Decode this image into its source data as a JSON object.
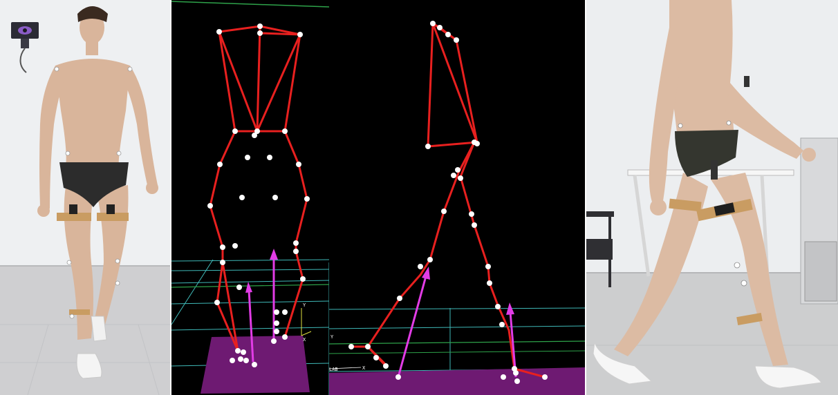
{
  "panels": {
    "front_photo": {
      "icon": "motion-capture-camera-icon"
    },
    "front_skeleton": {
      "axis_x_label": "X",
      "axis_y_label": "Y"
    },
    "side_skeleton": {
      "lab_label": "LAB",
      "axis_x_label": "X",
      "axis_y_label": "Y"
    },
    "side_photo": {}
  },
  "colors": {
    "bone": "#e8201f",
    "marker": "#ffffff",
    "force_vector": "#e23ce6",
    "force_plate": "#6e1a72",
    "grid": "#3fb9b8",
    "grid_green": "#2ea34a",
    "background_3d": "#000000"
  }
}
